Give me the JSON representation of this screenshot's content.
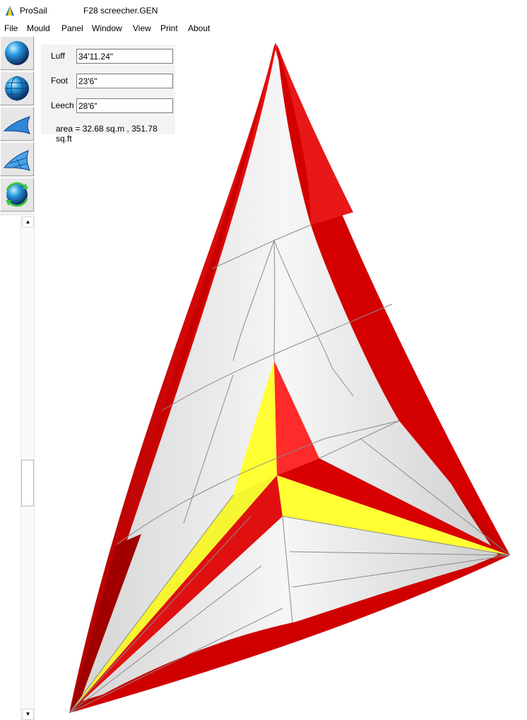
{
  "window": {
    "app_name": "ProSail",
    "document_title": "F28 screecher.GEN"
  },
  "menu": [
    "File",
    "Mould",
    "Panel",
    "Window",
    "View",
    "Print",
    "About"
  ],
  "toolbar": [
    {
      "icon": "sphere-icon"
    },
    {
      "icon": "globe-grid-icon"
    },
    {
      "icon": "sail-shape-icon"
    },
    {
      "icon": "sail-mesh-icon"
    },
    {
      "icon": "rotate-globe-icon"
    }
  ],
  "dimensions": {
    "luff_label": "Luff",
    "luff_value": "34'11.24\"",
    "foot_label": "Foot",
    "foot_value": "23'6\"",
    "leech_label": "Leech",
    "leech_value": "28'6\"",
    "area_text": "area = 32.68 sq.m , 351.78 sq.ft"
  },
  "colors": {
    "sail_red": "#d60000",
    "sail_yellow": "#ffff33",
    "sail_white": "#e8e8e8"
  }
}
